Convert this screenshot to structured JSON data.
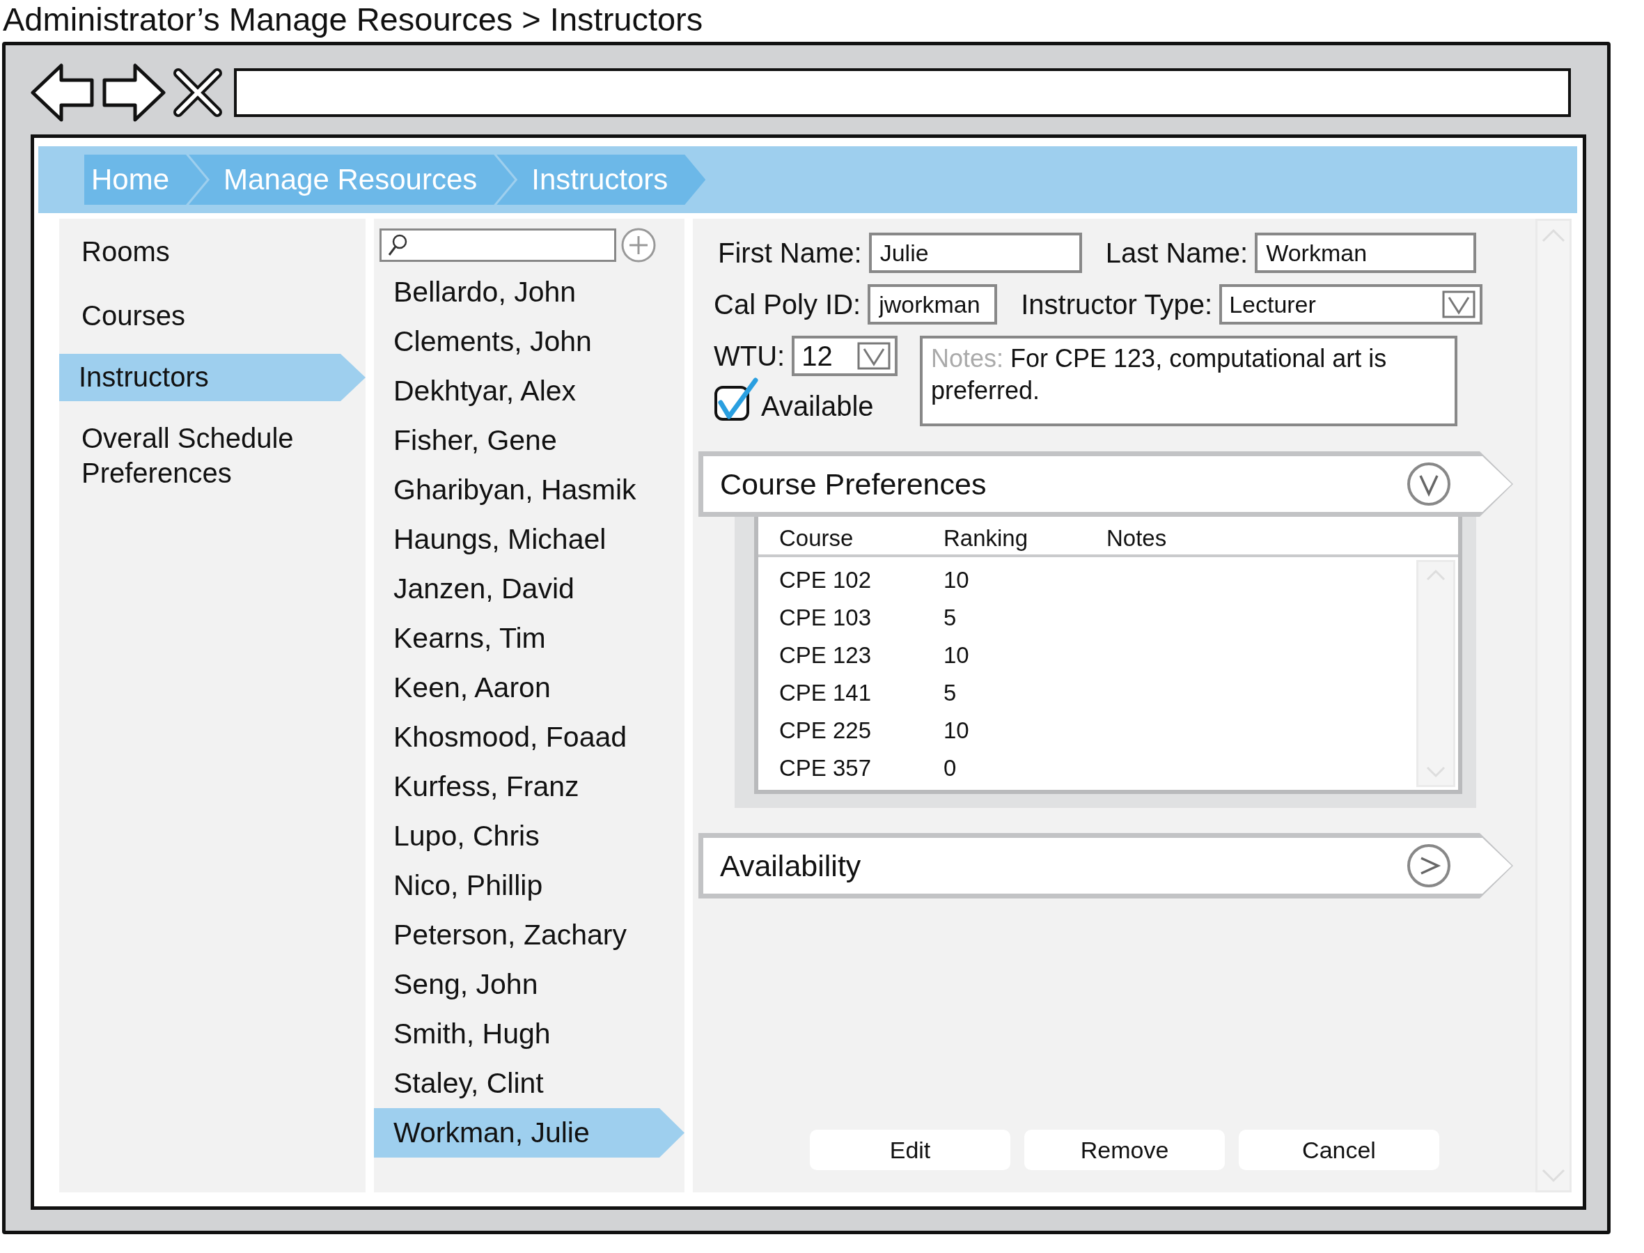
{
  "page_title": "Administrator’s Manage Resources > Instructors",
  "breadcrumbs": [
    {
      "label": "Home"
    },
    {
      "label": "Manage Resources"
    },
    {
      "label": "Instructors"
    }
  ],
  "nav": [
    {
      "label": "Rooms",
      "selected": false
    },
    {
      "label": "Courses",
      "selected": false
    },
    {
      "label": "Instructors",
      "selected": true
    },
    {
      "label": "Overall Schedule Preferences",
      "selected": false
    }
  ],
  "instructors": [
    {
      "name": "Bellardo, John",
      "selected": false
    },
    {
      "name": "Clements, John",
      "selected": false
    },
    {
      "name": "Dekhtyar, Alex",
      "selected": false
    },
    {
      "name": "Fisher, Gene",
      "selected": false
    },
    {
      "name": "Gharibyan, Hasmik",
      "selected": false
    },
    {
      "name": "Haungs, Michael",
      "selected": false
    },
    {
      "name": "Janzen, David",
      "selected": false
    },
    {
      "name": "Kearns, Tim",
      "selected": false
    },
    {
      "name": "Keen, Aaron",
      "selected": false
    },
    {
      "name": "Khosmood, Foaad",
      "selected": false
    },
    {
      "name": "Kurfess, Franz",
      "selected": false
    },
    {
      "name": "Lupo, Chris",
      "selected": false
    },
    {
      "name": "Nico, Phillip",
      "selected": false
    },
    {
      "name": "Peterson, Zachary",
      "selected": false
    },
    {
      "name": "Seng, John",
      "selected": false
    },
    {
      "name": "Smith, Hugh",
      "selected": false
    },
    {
      "name": "Staley, Clint",
      "selected": false
    },
    {
      "name": "Workman, Julie",
      "selected": true
    }
  ],
  "form": {
    "first_name": {
      "label": "First Name:",
      "value": "Julie"
    },
    "last_name": {
      "label": "Last Name:",
      "value": "Workman"
    },
    "cal_poly_id": {
      "label": "Cal Poly ID:",
      "value": "jworkman"
    },
    "instructor_type": {
      "label": "Instructor Type:",
      "value": "Lecturer"
    },
    "wtu": {
      "label": "WTU:",
      "value": "12"
    },
    "available": {
      "label": "Available",
      "checked": true
    },
    "notes": {
      "label": "Notes:",
      "value": "For CPE 123, computational art is preferred."
    }
  },
  "sections": [
    {
      "title": "Course Preferences",
      "expanded": true,
      "columns": [
        "Course",
        "Ranking",
        "Notes"
      ],
      "rows": [
        [
          "CPE 102",
          "10"
        ],
        [
          "CPE 103",
          "5"
        ],
        [
          "CPE 123",
          "10"
        ],
        [
          "CPE 141",
          "5"
        ],
        [
          "CPE 225",
          "10"
        ],
        [
          "CPE 357",
          "0"
        ]
      ]
    },
    {
      "title": "Availability",
      "expanded": false
    }
  ],
  "buttons": [
    "Edit",
    "Remove",
    "Cancel"
  ]
}
